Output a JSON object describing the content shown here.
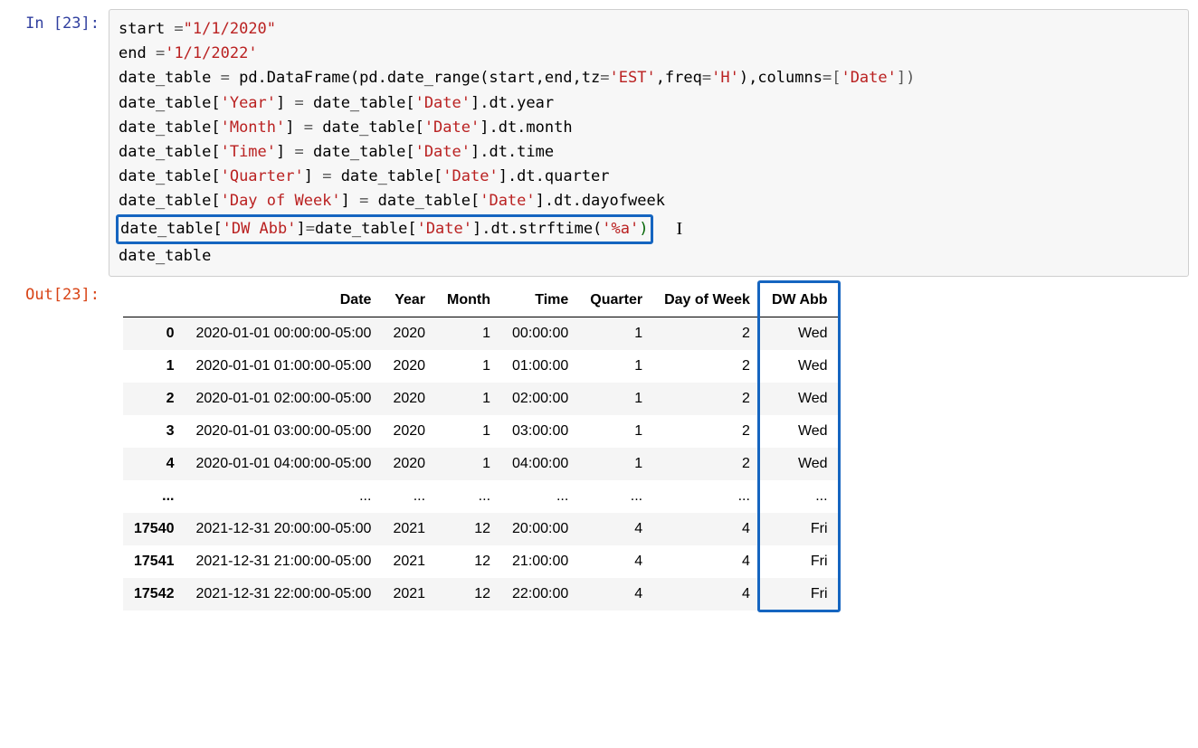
{
  "input": {
    "prompt": "In [23]:",
    "lines": [
      [
        {
          "t": "id",
          "v": "start "
        },
        {
          "t": "op",
          "v": "="
        },
        {
          "t": "str",
          "v": "\"1/1/2020\""
        }
      ],
      [
        {
          "t": "id",
          "v": "end "
        },
        {
          "t": "op",
          "v": "="
        },
        {
          "t": "str",
          "v": "'1/1/2022'"
        }
      ],
      [
        {
          "t": "id",
          "v": "date_table "
        },
        {
          "t": "op",
          "v": "= "
        },
        {
          "t": "id",
          "v": "pd.DataFrame(pd.date_range(start,end,tz"
        },
        {
          "t": "op",
          "v": "="
        },
        {
          "t": "str",
          "v": "'EST'"
        },
        {
          "t": "id",
          "v": ",freq"
        },
        {
          "t": "op",
          "v": "="
        },
        {
          "t": "str",
          "v": "'H'"
        },
        {
          "t": "id",
          "v": "),columns"
        },
        {
          "t": "op",
          "v": "=["
        },
        {
          "t": "str",
          "v": "'Date'"
        },
        {
          "t": "op",
          "v": "])"
        }
      ],
      [
        {
          "t": "id",
          "v": "date_table["
        },
        {
          "t": "str",
          "v": "'Year'"
        },
        {
          "t": "id",
          "v": "] "
        },
        {
          "t": "op",
          "v": "= "
        },
        {
          "t": "id",
          "v": "date_table["
        },
        {
          "t": "str",
          "v": "'Date'"
        },
        {
          "t": "id",
          "v": "].dt.year"
        }
      ],
      [
        {
          "t": "id",
          "v": "date_table["
        },
        {
          "t": "str",
          "v": "'Month'"
        },
        {
          "t": "id",
          "v": "] "
        },
        {
          "t": "op",
          "v": "= "
        },
        {
          "t": "id",
          "v": "date_table["
        },
        {
          "t": "str",
          "v": "'Date'"
        },
        {
          "t": "id",
          "v": "].dt.month"
        }
      ],
      [
        {
          "t": "id",
          "v": "date_table["
        },
        {
          "t": "str",
          "v": "'Time'"
        },
        {
          "t": "id",
          "v": "] "
        },
        {
          "t": "op",
          "v": "= "
        },
        {
          "t": "id",
          "v": "date_table["
        },
        {
          "t": "str",
          "v": "'Date'"
        },
        {
          "t": "id",
          "v": "].dt.time"
        }
      ],
      [
        {
          "t": "id",
          "v": "date_table["
        },
        {
          "t": "str",
          "v": "'Quarter'"
        },
        {
          "t": "id",
          "v": "] "
        },
        {
          "t": "op",
          "v": "= "
        },
        {
          "t": "id",
          "v": "date_table["
        },
        {
          "t": "str",
          "v": "'Date'"
        },
        {
          "t": "id",
          "v": "].dt.quarter"
        }
      ],
      [
        {
          "t": "id",
          "v": "date_table["
        },
        {
          "t": "str",
          "v": "'Day of Week'"
        },
        {
          "t": "id",
          "v": "] "
        },
        {
          "t": "op",
          "v": "= "
        },
        {
          "t": "id",
          "v": "date_table["
        },
        {
          "t": "str",
          "v": "'Date'"
        },
        {
          "t": "id",
          "v": "].dt.dayofweek"
        }
      ],
      [
        {
          "t": "hlstart",
          "v": ""
        },
        {
          "t": "id",
          "v": "date_table["
        },
        {
          "t": "str",
          "v": "'DW Abb'"
        },
        {
          "t": "id",
          "v": "]"
        },
        {
          "t": "op",
          "v": "="
        },
        {
          "t": "id",
          "v": "date_table["
        },
        {
          "t": "str",
          "v": "'Date'"
        },
        {
          "t": "id",
          "v": "].dt.strftime("
        },
        {
          "t": "str",
          "v": "'%a'"
        },
        {
          "t": "num",
          "v": ")"
        },
        {
          "t": "hlend",
          "v": ""
        },
        {
          "t": "cursor",
          "v": "I"
        }
      ],
      [
        {
          "t": "id",
          "v": "date_table"
        }
      ]
    ]
  },
  "output": {
    "prompt": "Out[23]:",
    "columns": [
      "",
      "Date",
      "Year",
      "Month",
      "Time",
      "Quarter",
      "Day of Week",
      "DW Abb"
    ],
    "rows": [
      {
        "index": "0",
        "Date": "2020-01-01 00:00:00-05:00",
        "Year": "2020",
        "Month": "1",
        "Time": "00:00:00",
        "Quarter": "1",
        "DayOfWeek": "2",
        "DWAbb": "Wed"
      },
      {
        "index": "1",
        "Date": "2020-01-01 01:00:00-05:00",
        "Year": "2020",
        "Month": "1",
        "Time": "01:00:00",
        "Quarter": "1",
        "DayOfWeek": "2",
        "DWAbb": "Wed"
      },
      {
        "index": "2",
        "Date": "2020-01-01 02:00:00-05:00",
        "Year": "2020",
        "Month": "1",
        "Time": "02:00:00",
        "Quarter": "1",
        "DayOfWeek": "2",
        "DWAbb": "Wed"
      },
      {
        "index": "3",
        "Date": "2020-01-01 03:00:00-05:00",
        "Year": "2020",
        "Month": "1",
        "Time": "03:00:00",
        "Quarter": "1",
        "DayOfWeek": "2",
        "DWAbb": "Wed"
      },
      {
        "index": "4",
        "Date": "2020-01-01 04:00:00-05:00",
        "Year": "2020",
        "Month": "1",
        "Time": "04:00:00",
        "Quarter": "1",
        "DayOfWeek": "2",
        "DWAbb": "Wed"
      },
      {
        "index": "...",
        "Date": "...",
        "Year": "...",
        "Month": "...",
        "Time": "...",
        "Quarter": "...",
        "DayOfWeek": "...",
        "DWAbb": "..."
      },
      {
        "index": "17540",
        "Date": "2021-12-31 20:00:00-05:00",
        "Year": "2021",
        "Month": "12",
        "Time": "20:00:00",
        "Quarter": "4",
        "DayOfWeek": "4",
        "DWAbb": "Fri"
      },
      {
        "index": "17541",
        "Date": "2021-12-31 21:00:00-05:00",
        "Year": "2021",
        "Month": "12",
        "Time": "21:00:00",
        "Quarter": "4",
        "DayOfWeek": "4",
        "DWAbb": "Fri"
      },
      {
        "index": "17542",
        "Date": "2021-12-31 22:00:00-05:00",
        "Year": "2021",
        "Month": "12",
        "Time": "22:00:00",
        "Quarter": "4",
        "DayOfWeek": "4",
        "DWAbb": "Fri"
      }
    ]
  }
}
